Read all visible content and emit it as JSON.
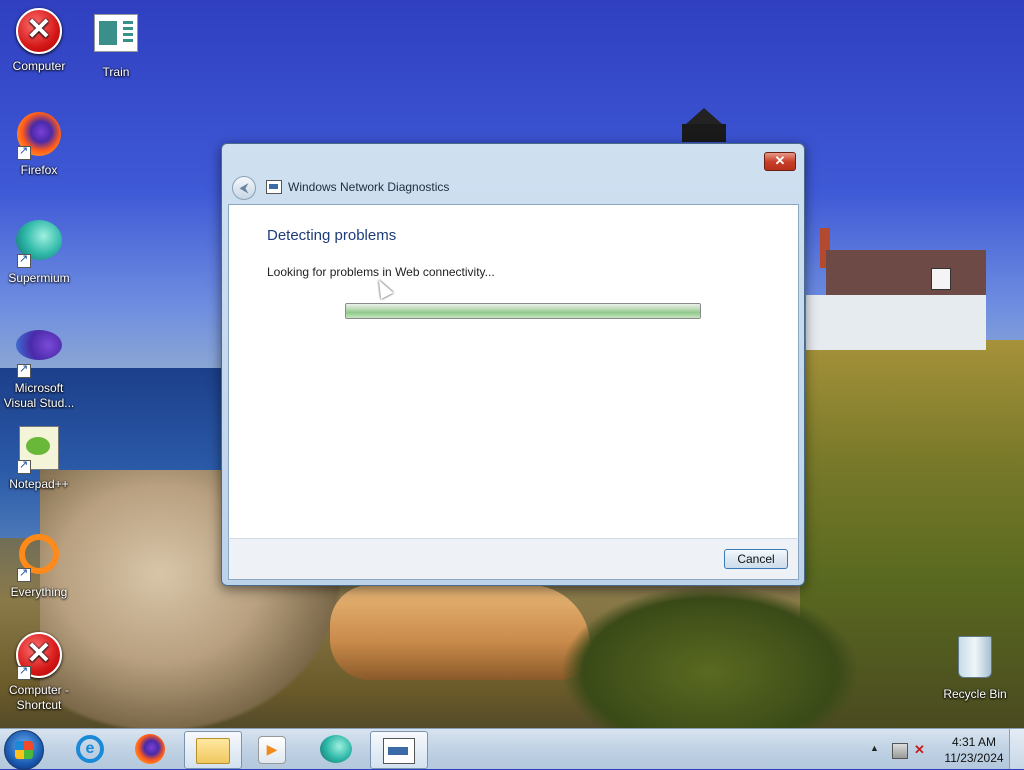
{
  "desktop": {
    "icons": [
      {
        "label": "Computer",
        "icon": "error-x-icon"
      },
      {
        "label": "Train",
        "icon": "presentation-icon"
      },
      {
        "label": "Firefox",
        "icon": "firefox-icon"
      },
      {
        "label": "Supermium",
        "icon": "supermium-icon"
      },
      {
        "label": "Microsoft Visual Stud...",
        "icon": "visual-studio-icon"
      },
      {
        "label": "Notepad++",
        "icon": "notepad-plus-plus-icon"
      },
      {
        "label": "Everything",
        "icon": "everything-search-icon"
      },
      {
        "label": "Computer - Shortcut",
        "icon": "error-x-icon"
      },
      {
        "label": "Recycle Bin",
        "icon": "recycle-bin-icon"
      }
    ]
  },
  "dialog": {
    "title": "Windows Network Diagnostics",
    "heading": "Detecting problems",
    "status": "Looking for problems in Web connectivity...",
    "progress": 1.0,
    "close_label": "✕",
    "cancel_label": "Cancel",
    "accent_color": "#1e3c78"
  },
  "taskbar": {
    "items": [
      {
        "name": "internet-explorer",
        "active": false
      },
      {
        "name": "firefox",
        "active": false
      },
      {
        "name": "windows-explorer",
        "active": true
      },
      {
        "name": "media-player",
        "active": false
      },
      {
        "name": "supermium",
        "active": false
      },
      {
        "name": "network-diagnostics",
        "active": true
      }
    ],
    "clock": {
      "time": "4:31 AM",
      "date": "11/23/2024"
    }
  }
}
